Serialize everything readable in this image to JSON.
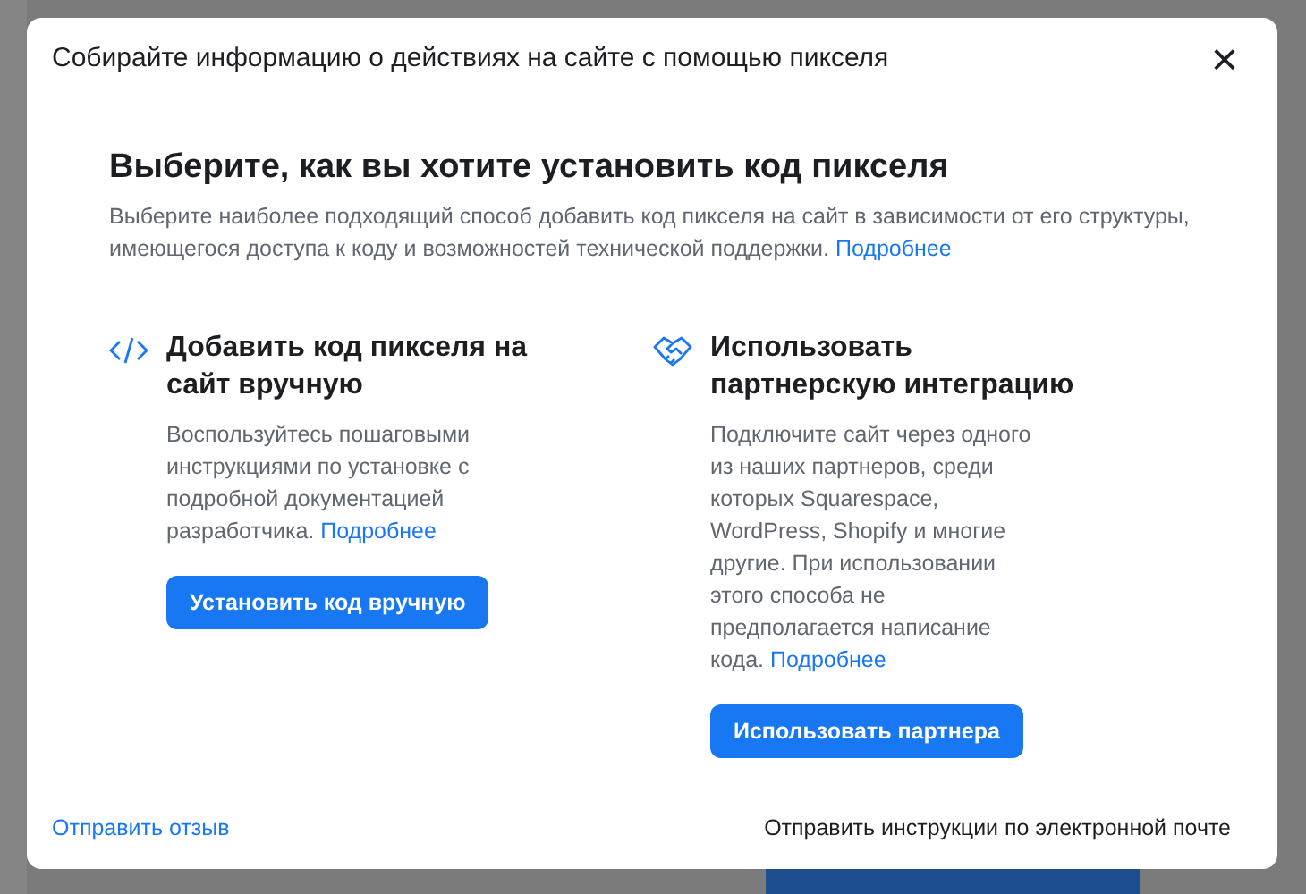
{
  "dialog": {
    "title": "Собирайте информацию о действиях на сайте с помощью пикселя",
    "close": "×"
  },
  "intro": {
    "heading": "Выберите, как вы хотите установить код пикселя",
    "text": "Выберите наиболее подходящий способ добавить код пикселя на сайт в зависимости от его структуры, имеющегося доступа к коду и возможностей технической поддержки.",
    "link": "Подробнее"
  },
  "options": [
    {
      "kind": "code",
      "heading": "Добавить код пикселя на сайт вручную",
      "text": "Воспользуйтесь пошаговыми инструкциями по установке с подробной документацией разработчика.",
      "link": "Подробнее",
      "button": "Установить код вручную"
    },
    {
      "kind": "partner",
      "heading": "Использовать партнерскую интеграцию",
      "text": "Подключите сайт через одного из наших партнеров, среди которых Squarespace, WordPress, Shopify и многие другие. При использовании этого способа не предполагается написание кода.",
      "link": "Подробнее",
      "button": "Использовать партнера"
    }
  ],
  "footer": {
    "feedback": "Отправить отзыв",
    "email": "Отправить инструкции по электронной почте"
  }
}
